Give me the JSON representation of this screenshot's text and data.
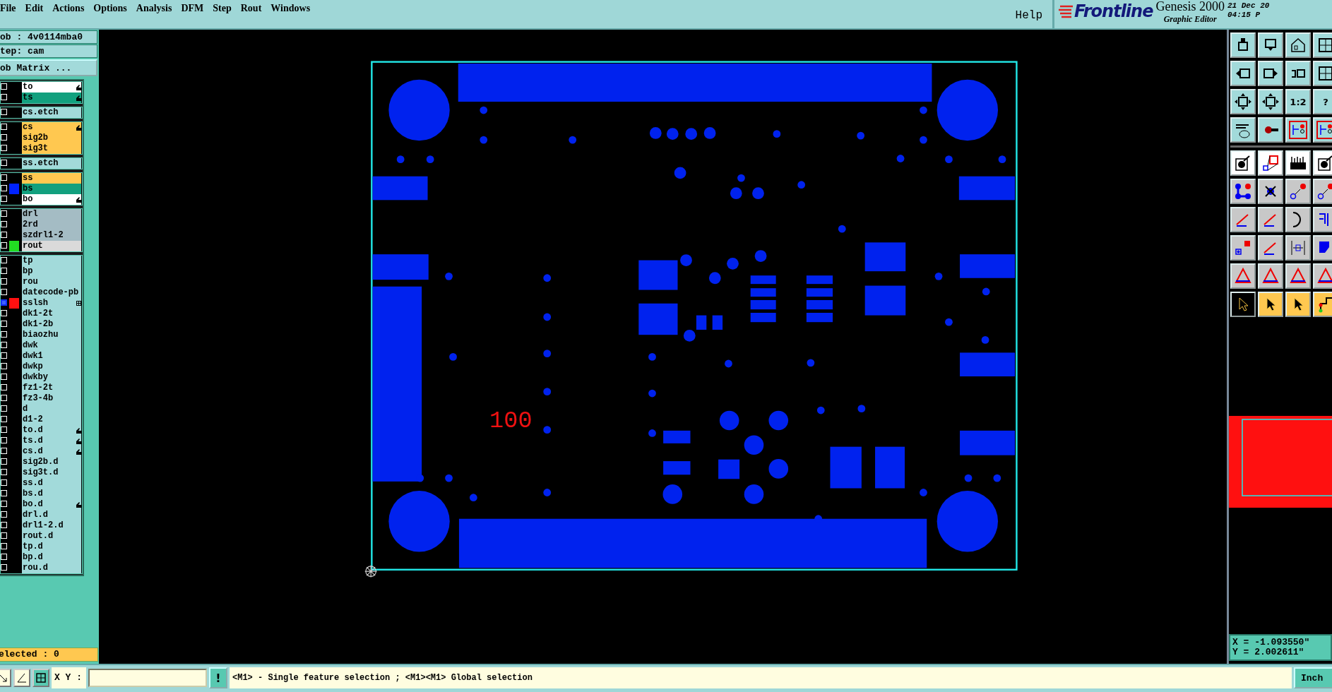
{
  "menu": [
    "File",
    "Edit",
    "Actions",
    "Options",
    "Analysis",
    "DFM",
    "Step",
    "Rout",
    "Windows"
  ],
  "help": "Help",
  "logo": "Frontline",
  "product": "Genesis 2000",
  "subtitle": "Graphic Editor",
  "date": "21 Dec 20",
  "time": "04:15 P",
  "job": "ob : 4v0114mba0",
  "step": "tep: cam",
  "matrix_button": "ob Matrix ...",
  "layer_groups": [
    {
      "layers": [
        {
          "name": "to",
          "kind": "silk",
          "affected": true,
          "flagged": false,
          "selected": false
        },
        {
          "name": "ts",
          "kind": "mask",
          "affected": true,
          "flagged": false,
          "selected": false
        }
      ]
    },
    {
      "layers": [
        {
          "name": "cs.etch",
          "kind": "misc",
          "affected": false,
          "flagged": false,
          "selected": false
        }
      ]
    },
    {
      "layers": [
        {
          "name": "cs",
          "kind": "signal",
          "affected": true,
          "flagged": false,
          "selected": false
        },
        {
          "name": "sig2b",
          "kind": "signal",
          "affected": false,
          "flagged": false,
          "selected": false
        },
        {
          "name": "sig3t",
          "kind": "signal",
          "affected": false,
          "flagged": false,
          "selected": false
        }
      ]
    },
    {
      "layers": [
        {
          "name": "ss.etch",
          "kind": "misc",
          "affected": false,
          "flagged": false,
          "selected": false
        }
      ]
    },
    {
      "layers": [
        {
          "name": "ss",
          "kind": "signal",
          "affected": false,
          "flagged": false,
          "selected": false
        },
        {
          "name": "bs",
          "kind": "mask",
          "affected": false,
          "flagged": false,
          "selected": false,
          "color": "#0022ff"
        },
        {
          "name": "bo",
          "kind": "silk",
          "affected": true,
          "flagged": false,
          "selected": false
        }
      ]
    },
    {
      "layers": [
        {
          "name": "drl",
          "kind": "drill",
          "affected": false,
          "flagged": false,
          "selected": false
        },
        {
          "name": "2rd",
          "kind": "drill",
          "affected": false,
          "flagged": false,
          "selected": false
        },
        {
          "name": "szdrl1-2",
          "kind": "drill",
          "affected": false,
          "flagged": false,
          "selected": false
        },
        {
          "name": "rout",
          "kind": "rout",
          "affected": false,
          "flagged": false,
          "selected": false,
          "color": "#22dd22"
        }
      ]
    },
    {
      "layers": [
        {
          "name": "tp",
          "kind": "misc",
          "affected": false,
          "flagged": false,
          "selected": false
        },
        {
          "name": "bp",
          "kind": "misc",
          "affected": false,
          "flagged": false,
          "selected": false
        },
        {
          "name": "rou",
          "kind": "misc",
          "affected": false,
          "flagged": false,
          "selected": false
        },
        {
          "name": "datecode-pb",
          "kind": "misc",
          "affected": false,
          "flagged": false,
          "selected": false
        },
        {
          "name": "sslsh",
          "kind": "misc",
          "affected": false,
          "flagged": true,
          "selected": true,
          "color": "#ff1010"
        },
        {
          "name": "dk1-2t",
          "kind": "misc",
          "affected": false,
          "flagged": false,
          "selected": false
        },
        {
          "name": "dk1-2b",
          "kind": "misc",
          "affected": false,
          "flagged": false,
          "selected": false
        },
        {
          "name": "biaozhu",
          "kind": "misc",
          "affected": false,
          "flagged": false,
          "selected": false
        },
        {
          "name": "dwk",
          "kind": "misc",
          "affected": false,
          "flagged": false,
          "selected": false
        },
        {
          "name": "dwk1",
          "kind": "misc",
          "affected": false,
          "flagged": false,
          "selected": false
        },
        {
          "name": "dwkp",
          "kind": "misc",
          "affected": false,
          "flagged": false,
          "selected": false
        },
        {
          "name": "dwkby",
          "kind": "misc",
          "affected": false,
          "flagged": false,
          "selected": false
        },
        {
          "name": "fz1-2t",
          "kind": "misc",
          "affected": false,
          "flagged": false,
          "selected": false
        },
        {
          "name": "fz3-4b",
          "kind": "misc",
          "affected": false,
          "flagged": false,
          "selected": false
        },
        {
          "name": "d",
          "kind": "misc",
          "affected": false,
          "flagged": false,
          "selected": false
        },
        {
          "name": "d1-2",
          "kind": "misc",
          "affected": false,
          "flagged": false,
          "selected": false
        },
        {
          "name": "to.d",
          "kind": "misc",
          "affected": true,
          "flagged": false,
          "selected": false
        },
        {
          "name": "ts.d",
          "kind": "misc",
          "affected": true,
          "flagged": false,
          "selected": false
        },
        {
          "name": "cs.d",
          "kind": "misc",
          "affected": true,
          "flagged": false,
          "selected": false
        },
        {
          "name": "sig2b.d",
          "kind": "misc",
          "affected": false,
          "flagged": false,
          "selected": false
        },
        {
          "name": "sig3t.d",
          "kind": "misc",
          "affected": false,
          "flagged": false,
          "selected": false
        },
        {
          "name": "ss.d",
          "kind": "misc",
          "affected": false,
          "flagged": false,
          "selected": false
        },
        {
          "name": "bs.d",
          "kind": "misc",
          "affected": false,
          "flagged": false,
          "selected": false
        },
        {
          "name": "bo.d",
          "kind": "misc",
          "affected": true,
          "flagged": false,
          "selected": false
        },
        {
          "name": "drl.d",
          "kind": "misc",
          "affected": false,
          "flagged": false,
          "selected": false
        },
        {
          "name": "drl1-2.d",
          "kind": "misc",
          "affected": false,
          "flagged": false,
          "selected": false
        },
        {
          "name": "rout.d",
          "kind": "misc",
          "affected": false,
          "flagged": false,
          "selected": false
        },
        {
          "name": "tp.d",
          "kind": "misc",
          "affected": false,
          "flagged": false,
          "selected": false
        },
        {
          "name": "bp.d",
          "kind": "misc",
          "affected": false,
          "flagged": false,
          "selected": false
        },
        {
          "name": "rou.d",
          "kind": "misc",
          "affected": false,
          "flagged": false,
          "selected": false
        }
      ]
    }
  ],
  "selected_count": "elected : 0",
  "board_label": "100",
  "tool_labels": [
    "1:2",
    "?"
  ],
  "pick_tools": [
    {
      "selected": true
    },
    {
      "selected": false
    },
    {
      "selected": false
    },
    {
      "selected": false
    }
  ],
  "coords": [
    "X = -1.093550\"",
    "Y = 2.002611\""
  ],
  "status": {
    "xy_label": "X Y :",
    "alert": "!",
    "message": "<M1> - Single feature selection ; <M1><M1> Global selection",
    "unit": "Inch"
  }
}
